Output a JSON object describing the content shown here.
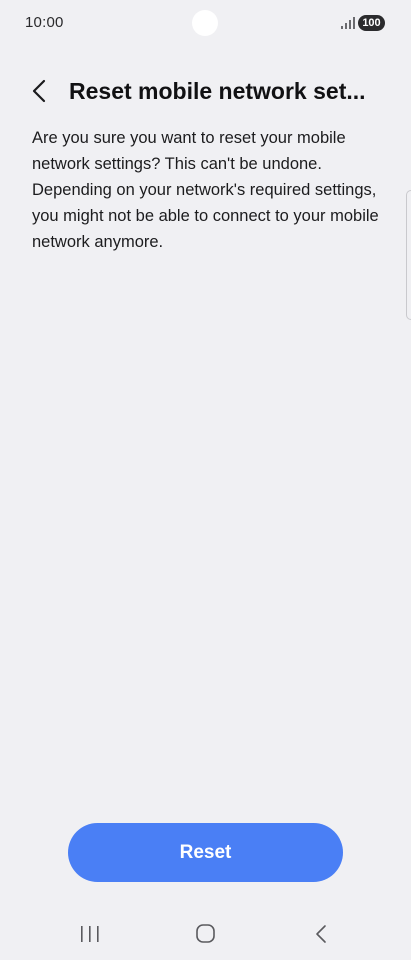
{
  "status_bar": {
    "time": "10:00",
    "battery": "100",
    "icons": [
      "signal-icon",
      "battery-icon"
    ]
  },
  "header": {
    "title": "Reset mobile network set...",
    "back_icon": "chevron-left-icon"
  },
  "body": {
    "description": "Are you sure you want to reset your mobile network settings? This can't be undone. Depending on your network's required settings, you might not be able to connect to your mobile network anymore."
  },
  "actions": {
    "reset_label": "Reset"
  },
  "nav_bar": {
    "icons": [
      "recents-icon",
      "home-icon",
      "back-icon"
    ]
  },
  "colors": {
    "background": "#f0f0f3",
    "accent": "#4a7ff5",
    "text": "#1b1b1d"
  }
}
